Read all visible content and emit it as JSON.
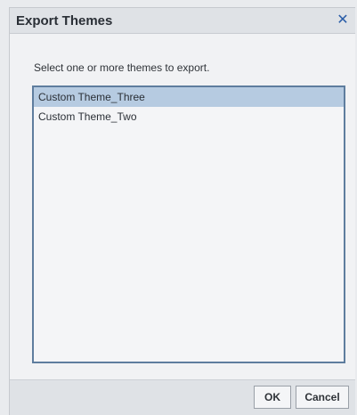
{
  "dialog": {
    "title": "Export Themes",
    "close_symbol": "✕",
    "close_icon": "close-icon",
    "instruction": "Select one or more themes to export.",
    "themes": [
      {
        "label": "Custom Theme_Three",
        "selected": true
      },
      {
        "label": "Custom Theme_Two",
        "selected": false
      }
    ],
    "buttons": {
      "ok_label": "OK",
      "cancel_label": "Cancel"
    }
  },
  "colors": {
    "accent_close": "#2a5da8",
    "selection": "#b6cbe1",
    "list_border": "#5e7d9e"
  }
}
